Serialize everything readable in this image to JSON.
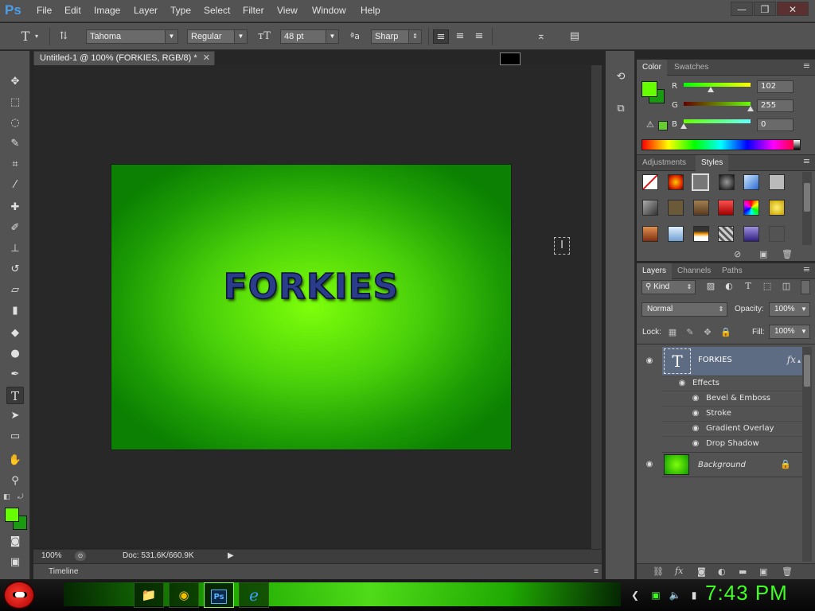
{
  "app": {
    "logo": "Ps"
  },
  "menu": [
    "File",
    "Edit",
    "Image",
    "Layer",
    "Type",
    "Select",
    "Filter",
    "View",
    "Window",
    "Help"
  ],
  "window_controls": {
    "minimize": "—",
    "restore": "❐",
    "close": "✕"
  },
  "options_bar": {
    "font_family": "Tahoma",
    "font_style": "Regular",
    "font_size": "48 pt",
    "antialias_icon_label": "ªa",
    "antialias": "Sharp",
    "text_color": "#000000"
  },
  "document": {
    "tab_title": "Untitled-1 @ 100% (FORKIES, RGB/8) *",
    "canvas_text": "FORKIES",
    "zoom": "100%",
    "doc_size": "Doc: 531.6K/660.9K"
  },
  "timeline": {
    "label": "Timeline"
  },
  "color_panel": {
    "tabs": [
      "Color",
      "Swatches"
    ],
    "active_tab": "Color",
    "foreground": "#66ff00",
    "background": "#1a9a10",
    "channels": [
      {
        "label": "R",
        "value": "102",
        "fraction": 0.4
      },
      {
        "label": "G",
        "value": "255",
        "fraction": 1.0
      },
      {
        "label": "B",
        "value": "0",
        "fraction": 0.0
      }
    ]
  },
  "styles_panel": {
    "tabs": [
      "Adjustments",
      "Styles"
    ],
    "active_tab": "Styles"
  },
  "layers_panel": {
    "tabs": [
      "Layers",
      "Channels",
      "Paths"
    ],
    "active_tab": "Layers",
    "filter_kind": "Kind",
    "blend_mode": "Normal",
    "opacity_label": "Opacity:",
    "opacity": "100%",
    "lock_label": "Lock:",
    "fill_label": "Fill:",
    "fill": "100%",
    "layers": [
      {
        "name": "FORKIES",
        "thumb": "T",
        "fx": "fx",
        "effects_label": "Effects",
        "effects": [
          "Bevel & Emboss",
          "Stroke",
          "Gradient Overlay",
          "Drop Shadow"
        ]
      },
      {
        "name": "Background"
      }
    ]
  },
  "taskbar": {
    "clock": "7:43 PM",
    "apps": [
      {
        "name": "file-explorer",
        "glyph": "📁"
      },
      {
        "name": "chrome",
        "glyph": "◉"
      },
      {
        "name": "photoshop",
        "glyph": "Ps"
      },
      {
        "name": "internet-explorer",
        "glyph": "ℯ"
      }
    ]
  }
}
